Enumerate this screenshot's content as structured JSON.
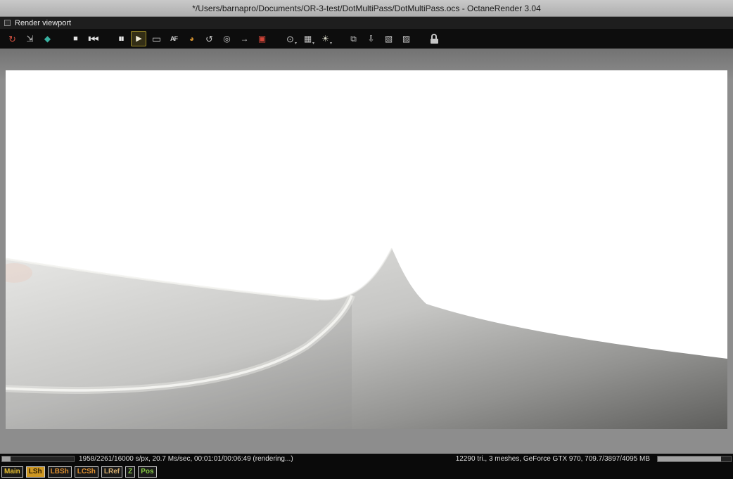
{
  "window": {
    "title": "*/Users/barnapro/Documents/OR-3-test/DotMultiPass/DotMultiPass.ocs - OctaneRender 3.04"
  },
  "viewport_header": {
    "title": "Render viewport"
  },
  "toolbar": {
    "dropdown_glyph": "▾",
    "icons": [
      {
        "name": "restart-render-icon",
        "glyph": "↻",
        "color": "#d05040",
        "size": 13
      },
      {
        "name": "fit-view-icon",
        "glyph": "⇲",
        "color": "#c4c4c4",
        "size": 12
      },
      {
        "name": "scene-objects-icon",
        "glyph": "◆",
        "color": "#38b0a0",
        "size": 12
      },
      {
        "name": "stop-render-icon",
        "glyph": "■",
        "color": "#e4e4e4",
        "size": 11
      },
      {
        "name": "restart-sequence-icon",
        "glyph": "▮◀◀",
        "color": "#e4e4e4",
        "size": 8
      },
      {
        "name": "pause-icon",
        "glyph": "▮▮",
        "color": "#e4e4e4",
        "size": 8
      },
      {
        "name": "play-icon",
        "glyph": "▶",
        "color": "#f0ecd8",
        "size": 11,
        "active": true
      },
      {
        "name": "display-modes-icon",
        "glyph": "▭",
        "color": "#d0d0d0",
        "size": 14
      },
      {
        "name": "autofocus-icon",
        "glyph": "AF",
        "color": "#d0d0d0",
        "size": 9
      },
      {
        "name": "white-balance-picker-icon",
        "glyph": "◕",
        "color": "#d09030",
        "size": 12
      },
      {
        "name": "rotate-view-icon",
        "glyph": "↺",
        "color": "#c4c4c4",
        "size": 13
      },
      {
        "name": "focus-picker-icon",
        "glyph": "◎",
        "color": "#c4c4c4",
        "size": 12
      },
      {
        "name": "object-picker-icon",
        "glyph": "→",
        "color": "#c4c4c4",
        "size": 12
      },
      {
        "name": "material-picker-icon",
        "glyph": "▣",
        "color": "#d04438",
        "size": 12
      },
      {
        "name": "zoom-tool-icon",
        "glyph": "⊙",
        "color": "#c4c4c4",
        "size": 13,
        "dropdown": true
      },
      {
        "name": "region-render-icon",
        "glyph": "▦",
        "color": "#c4c4c4",
        "size": 12,
        "dropdown": true
      },
      {
        "name": "render-priority-icon",
        "glyph": "☀",
        "color": "#d8d8c8",
        "size": 12,
        "dropdown": true
      },
      {
        "name": "copy-image-icon",
        "glyph": "⧉",
        "color": "#c4c4c4",
        "size": 12
      },
      {
        "name": "save-image-icon",
        "glyph": "⇩",
        "color": "#c4c4c4",
        "size": 12
      },
      {
        "name": "save-render-state-icon",
        "glyph": "▧",
        "color": "#c4c4c4",
        "size": 12
      },
      {
        "name": "export-passes-icon",
        "glyph": "▨",
        "color": "#c4c4c4",
        "size": 12
      }
    ]
  },
  "status_bar": {
    "left_text": "1958/2261/16000 s/px, 20.7 Ms/sec, 00:01:01/00:06:49 (rendering...)",
    "right_text": "12290 tri., 3 meshes, GeForce GTX 970, 709.7/3897/4095 MB",
    "left_progress_percent": 12,
    "right_progress_percent": 87
  },
  "passes": [
    {
      "label": "Main",
      "text_color": "#e8c030",
      "bg_color": "#1a1a1a",
      "active": false
    },
    {
      "label": "LSh",
      "text_color": "#2a1a00",
      "bg_color": "#cc9622",
      "active": true
    },
    {
      "label": "LBSh",
      "text_color": "#e09030",
      "bg_color": "#1a1a1a",
      "active": false
    },
    {
      "label": "LCSh",
      "text_color": "#e09030",
      "bg_color": "#1a1a1a",
      "active": false
    },
    {
      "label": "LRef",
      "text_color": "#d8b070",
      "bg_color": "#1a1a1a",
      "active": false
    },
    {
      "label": "Z",
      "text_color": "#88cc44",
      "bg_color": "#1a1a1a",
      "active": false
    },
    {
      "label": "Pos",
      "text_color": "#88cc44",
      "bg_color": "#1a1a1a",
      "active": false
    }
  ]
}
